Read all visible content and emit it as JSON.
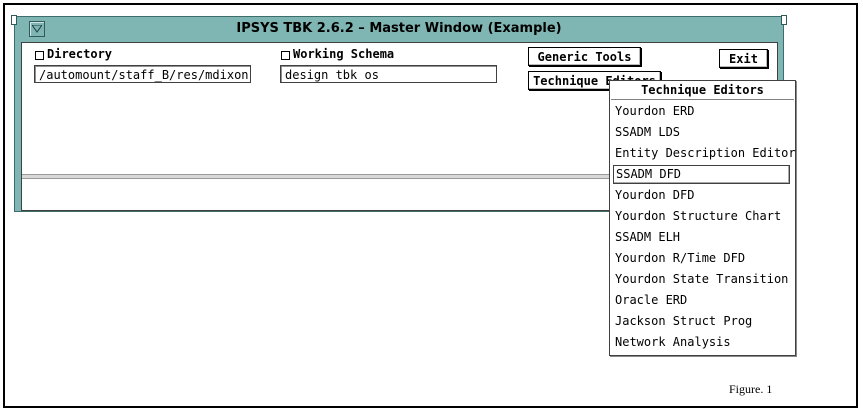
{
  "window": {
    "title": "IPSYS TBK 2.6.2 – Master Window (Example)"
  },
  "directory": {
    "label": "Directory",
    "value": "/automount/staff_B/res/mdixon"
  },
  "working_schema": {
    "label": "Working Schema",
    "value": "design tbk os"
  },
  "buttons": {
    "generic_tools": "Generic Tools",
    "technique_editors": "Technique Editors",
    "exit": "Exit"
  },
  "menu": {
    "title": "Technique Editors",
    "selected_index": 3,
    "items": [
      "Yourdon ERD",
      "SSADM LDS",
      "Entity Description Editor",
      "SSADM DFD",
      "Yourdon DFD",
      "Yourdon Structure Chart",
      "SSADM ELH",
      "Yourdon R/Time DFD",
      "Yourdon State Transition",
      "Oracle ERD",
      "Jackson Struct Prog",
      "Network Analysis"
    ]
  },
  "caption": "Figure. 1",
  "colors": {
    "window_frame": "#7fb6b3"
  }
}
